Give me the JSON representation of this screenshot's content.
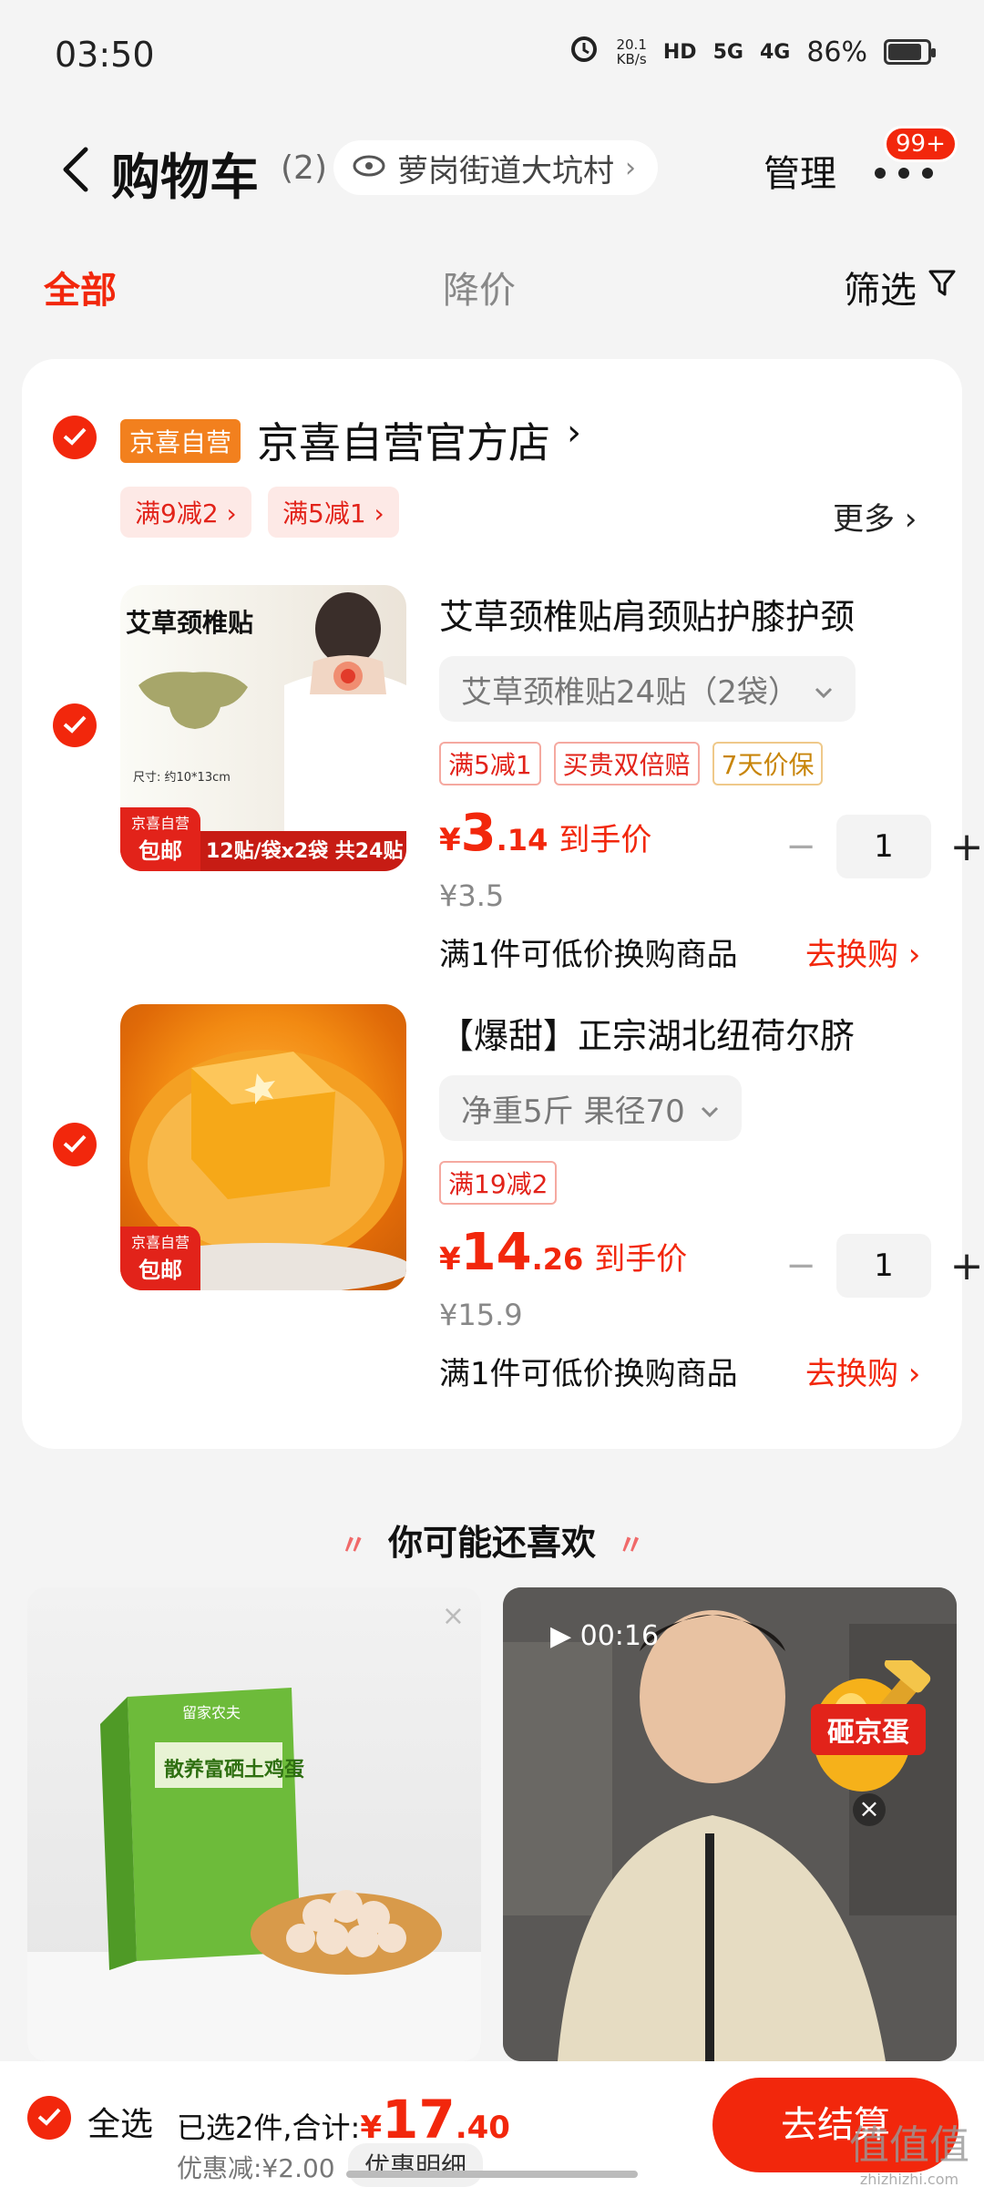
{
  "status_bar": {
    "time": "03:50",
    "net_speed_value": "20.1",
    "net_speed_unit": "KB/s",
    "hd_label": "HD",
    "signal1": "5G",
    "signal2": "4G",
    "battery_text": "86%",
    "battery_level": 0.86
  },
  "header": {
    "title": "购物车",
    "count": "(2)",
    "location": "萝岗街道大坑村",
    "manage": "管理",
    "badge": "99+"
  },
  "tabs": {
    "all": "全部",
    "price_drop": "降价",
    "filter": "筛选"
  },
  "store": {
    "tag": "京喜自营",
    "name": "京喜自营官方店",
    "promos": [
      "满9减2 ›",
      "满5减1 ›"
    ],
    "more": "更多 ›"
  },
  "items": [
    {
      "title": "艾草颈椎贴肩颈贴护膝护颈",
      "spec": "艾草颈椎贴24贴（2袋）",
      "tags": [
        "满5减1",
        "买贵双倍赔",
        "7天价保"
      ],
      "price_currency": "¥",
      "price_int": "3",
      "price_dec": ".14",
      "price_label": "到手价",
      "original_price": "¥3.5",
      "qty": "1",
      "swap_note": "满1件可低价换购商品",
      "swap_link": "去换购 ›",
      "thumb_title": "艾草颈椎贴",
      "thumb_size": "尺寸: 约10*13cm",
      "thumb_footer": "12贴/袋x2袋 共24贴",
      "self_badge_top": "京喜自营",
      "self_badge_bottom": "包邮"
    },
    {
      "title": "【爆甜】正宗湖北纽荷尔脐",
      "spec": "净重5斤 果径70",
      "tags": [
        "满19减2"
      ],
      "price_currency": "¥",
      "price_int": "14",
      "price_dec": ".26",
      "price_label": "到手价",
      "original_price": "¥15.9",
      "qty": "1",
      "swap_note": "满1件可低价换购商品",
      "swap_link": "去换购 ›",
      "self_badge_top": "京喜自营",
      "self_badge_bottom": "包邮"
    }
  ],
  "recommend": {
    "title": "你可能还喜欢",
    "left_box_text": "散养富硒土鸡蛋",
    "left_box_brand": "留家农夫",
    "right_timer": "▶ 00:16",
    "right_banner": "砸京蛋"
  },
  "bottom": {
    "select_all": "全选",
    "selected_text": "已选2件,合计:",
    "total_currency": "¥",
    "total_int": "17",
    "total_dec": ".40",
    "discount": "优惠减:¥2.00",
    "detail": "优惠明细",
    "checkout": "去结算"
  },
  "watermark": {
    "main": "值值值",
    "sub": "zhizhizhi.com"
  },
  "colors": {
    "accent": "#f2270c",
    "store_tag": "#f2801e"
  }
}
